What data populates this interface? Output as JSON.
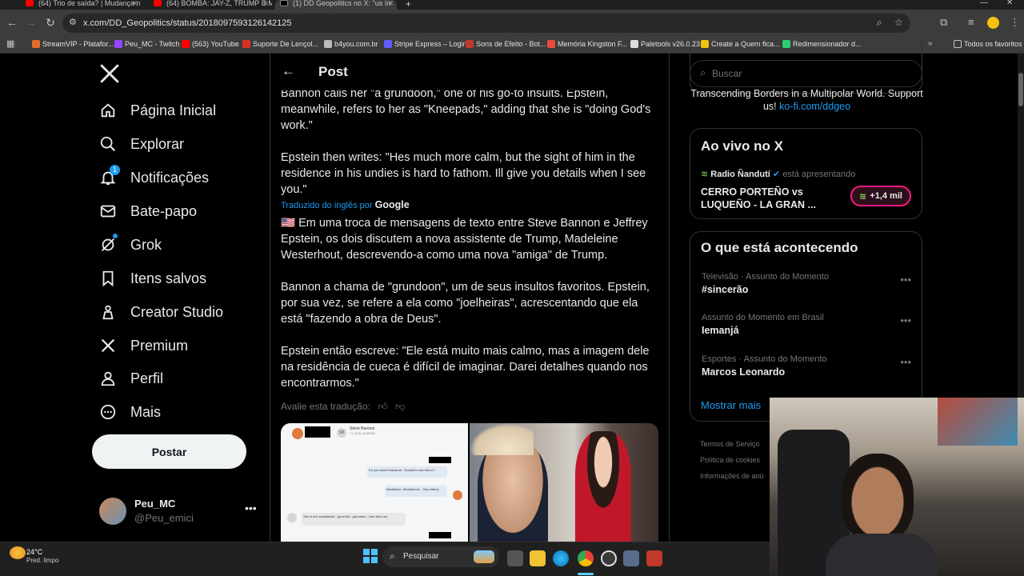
{
  "browser": {
    "tabs": [
      {
        "title": "(64) Trio de saída? | Mudança n"
      },
      {
        "title": "(64) BOMBA: JAY-Z, TRUMP E M"
      },
      {
        "title": "(1) DD Geopolitics no X: \"us ín"
      }
    ],
    "url": "x.com/DD_Geopolitics/status/2018097593126142125",
    "bookmarks": [
      {
        "label": "StreamVIP - Platafor...",
        "color": "#e46b2c"
      },
      {
        "label": "Peu_MC - Twitch",
        "color": "#9146ff"
      },
      {
        "label": "(563) YouTube",
        "color": "#ff0000"
      },
      {
        "label": "Suporte De Lençol...",
        "color": "#d93025"
      },
      {
        "label": "b4you.com.br",
        "color": "#bbbbbb"
      },
      {
        "label": "Stripe Express – Login",
        "color": "#635bff"
      },
      {
        "label": "Sons de Efeito - Bot...",
        "color": "#c0392b"
      },
      {
        "label": "Memória Kingston F...",
        "color": "#e74c3c"
      },
      {
        "label": "Paletools v26.0.23",
        "color": "#dddddd"
      },
      {
        "label": "Create a Quem fica...",
        "color": "#f1c40f"
      },
      {
        "label": "Redimensionador d...",
        "color": "#2ecc71"
      }
    ],
    "all_bookmarks": "Todos os favoritos"
  },
  "nav": {
    "items": [
      {
        "label": "Página Inicial",
        "icon": "home-icon"
      },
      {
        "label": "Explorar",
        "icon": "search-icon"
      },
      {
        "label": "Notificações",
        "icon": "bell-icon",
        "badge": "1"
      },
      {
        "label": "Bate-papo",
        "icon": "mail-icon"
      },
      {
        "label": "Grok",
        "icon": "grok-icon"
      },
      {
        "label": "Itens salvos",
        "icon": "bookmark-icon"
      },
      {
        "label": "Creator Studio",
        "icon": "creator-icon"
      },
      {
        "label": "Premium",
        "icon": "x-logo-icon"
      },
      {
        "label": "Perfil",
        "icon": "person-icon"
      },
      {
        "label": "Mais",
        "icon": "more-icon"
      }
    ],
    "post_button": "Postar",
    "profile": {
      "name": "Peu_MC",
      "handle": "@Peu_emici"
    }
  },
  "post": {
    "header_title": "Post",
    "original_p1": "Bannon calls her \"a grundoon,\" one of his go-to insults. Epstein, meanwhile, refers to her as \"Kneepads,\" adding that she is \"doing God's work.\"",
    "original_p2": "Epstein then writes: \"Hes much more calm, but the sight of him in the residence in his undies is hard to fathom. Ill give you details when I see you.\"",
    "translated_label": "Traduzido do inglês por",
    "translated_by": "Google",
    "translation_p1": "🇺🇸 Em uma troca de mensagens de texto entre Steve Bannon e Jeffrey Epstein, os dois discutem a nova assistente de Trump, Madeleine Westerhout, descrevendo-a como uma nova \"amiga\" de Trump.",
    "translation_p2": "Bannon a chama de \"grundoon\", um de seus insultos favoritos. Epstein, por sua vez, se refere a ela como \"joelheiras\", acrescentando que ela está \"fazendo a obra de Deus\".",
    "translation_p3": "Epstein então escreve: \"Ele está muito mais calmo, mas a imagem dele na residência de cueca é difícil de imaginar. Darei detalhes quando nos encontrarmos.\"",
    "rate_translation": "Avalie esta tradução:",
    "chat_image": {
      "contact": "Steve Bannon",
      "sub": "+1 (202) 3849536",
      "msg1": "Do you know Manamar - Donald's new friend ?",
      "msg2": "Madeleine, Westerhout... Very Mercy",
      "msg3": "She is the receptionist - good kid - grundoon - cam from me"
    }
  },
  "sidebar": {
    "search_placeholder": "Buscar",
    "promo_text": "Transcending Borders in a Multipolar World. Support us!",
    "promo_link": "ko-fi.com/ddgeo",
    "live": {
      "title": "Ao vivo no X",
      "host": "Radio Ñandutí",
      "host_status": "está apresentando",
      "show": "CERRO PORTEÑO vs LUQUEÑO - LA GRAN ...",
      "listeners": "+1,4 mil"
    },
    "trending_title": "O que está acontecendo",
    "trends": [
      {
        "meta": "Televisão · Assunto do Momento",
        "name": "#sincerão"
      },
      {
        "meta": "Assunto do Momento em Brasil",
        "name": "Iemanjá"
      },
      {
        "meta": "Esportes · Assunto do Momento",
        "name": "Marcos Leonardo"
      }
    ],
    "show_more": "Mostrar mais",
    "footer": [
      "Termos de Serviço",
      "Política de cookies",
      "Informações de anú"
    ]
  },
  "taskbar": {
    "weather_temp": "24°C",
    "weather_desc": "Pred. limpo",
    "search": "Pesquisar"
  },
  "colors": {
    "accent": "#1d9bf0",
    "bg": "#000000",
    "border": "#2f3336",
    "live_pill": "#f91880"
  }
}
